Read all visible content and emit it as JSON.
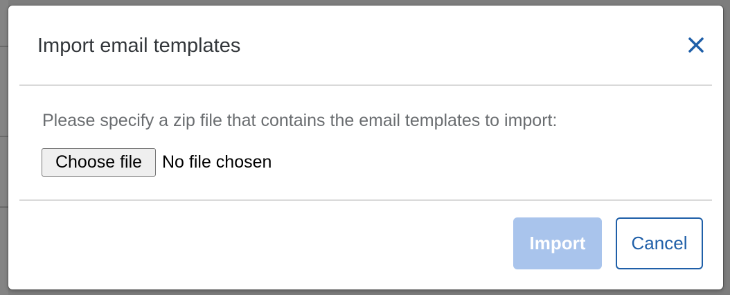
{
  "dialog": {
    "title": "Import email templates",
    "close_icon": "close-icon"
  },
  "body": {
    "instruction": "Please specify a zip file that contains the email templates to import:",
    "choose_file_label": "Choose file",
    "file_status": "No file chosen"
  },
  "footer": {
    "import_label": "Import",
    "cancel_label": "Cancel"
  },
  "colors": {
    "accent": "#1f5fa8",
    "import_disabled_bg": "#a9c4ec",
    "title_text": "#32363a",
    "muted_text": "#6a6d70"
  }
}
